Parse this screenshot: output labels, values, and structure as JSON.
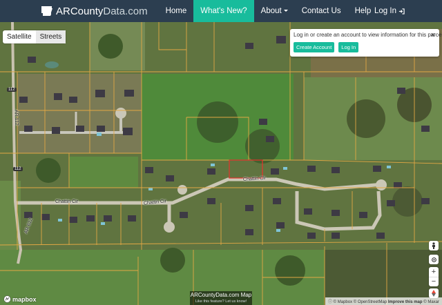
{
  "navbar": {
    "brand_name": "ARCounty",
    "brand_tld": "Data.com",
    "items": [
      {
        "label": "Home"
      },
      {
        "label": "What's New?"
      },
      {
        "label": "About"
      },
      {
        "label": "Contact Us"
      },
      {
        "label": "Help"
      }
    ],
    "login_label": "Log In"
  },
  "layer_toggle": {
    "satellite": "Satellite",
    "streets": "Streets",
    "active": "Streets"
  },
  "popup": {
    "message": "Log in or create an account to view information for this parcel.",
    "create_account": "Create Account",
    "log_in": "Log In",
    "close": "×"
  },
  "streets": {
    "chattin_cir_1": "Chattin Cir",
    "chattin_cir_2": "Chattin Cir",
    "chattin_cir_3": "Chattin Cir",
    "hwy_112": "112",
    "hwy_112_b": "112",
    "ar_112": "AR 112",
    "hwy_612": "AR 612"
  },
  "controls": {
    "zoom_in": "+",
    "zoom_out": "−"
  },
  "footer": {
    "title": "ARCountyData.com Map",
    "subtitle": "Like this feature? Let us know!"
  },
  "mapbox": {
    "label": "mapbox"
  },
  "attribution": {
    "mapbox": "© Mapbox",
    "osm": "© OpenStreetMap",
    "improve": "Improve this map",
    "maxar": "© Maxar"
  },
  "colors": {
    "navbar": "#2c3e50",
    "accent": "#18bc9c",
    "parcel_line": "#e3a844",
    "selected_parcel": "#e8322c"
  }
}
